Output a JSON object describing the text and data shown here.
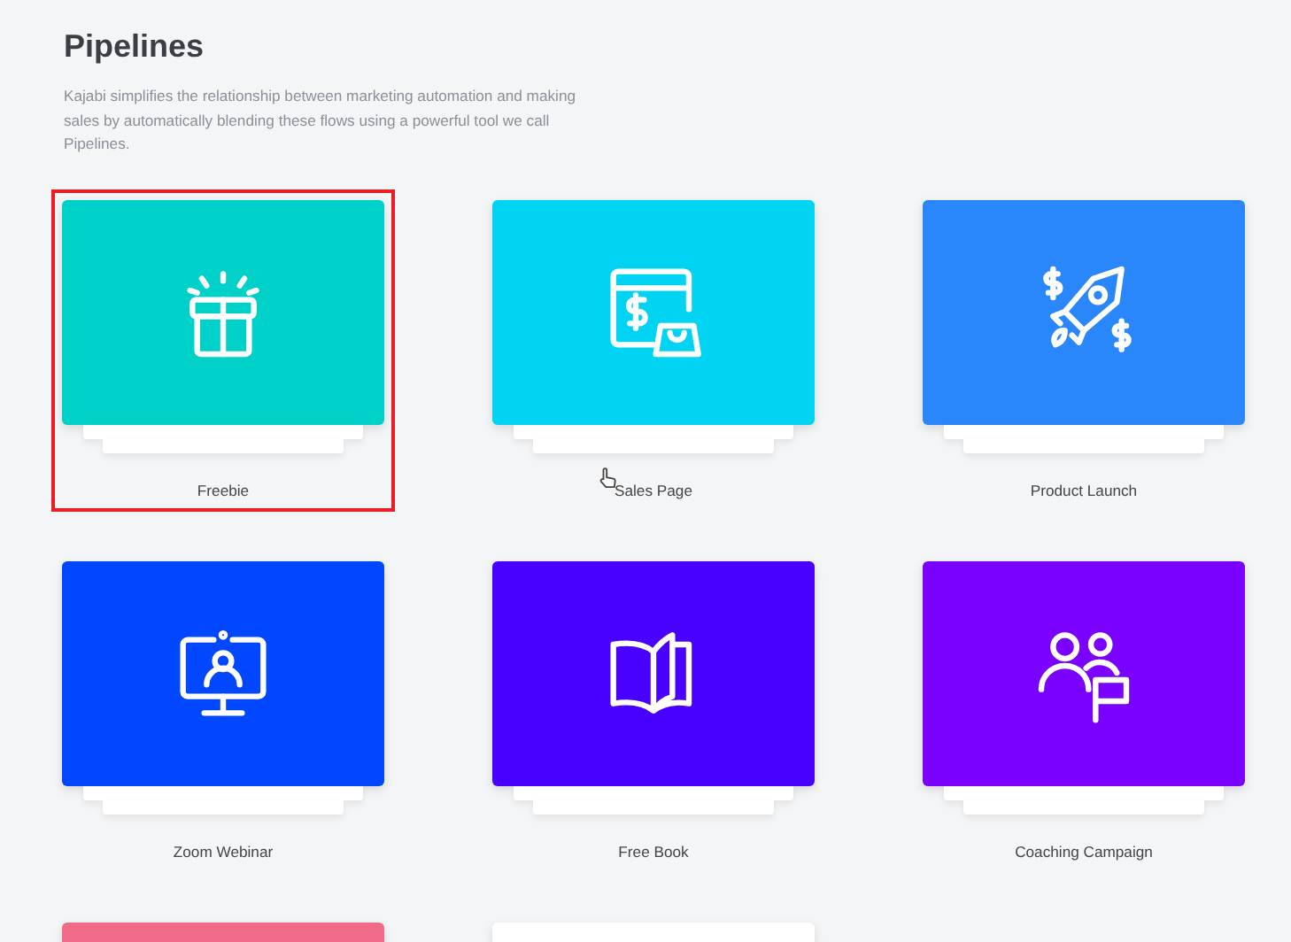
{
  "page": {
    "title": "Pipelines",
    "description": "Kajabi simplifies the relationship between marketing automation and making sales by automatically blending these flows using a powerful tool we call Pipelines."
  },
  "pipelines": [
    {
      "label": "Freebie",
      "kind": "gift",
      "color": "#00d1c8",
      "selected": true
    },
    {
      "label": "Sales Page",
      "kind": "store",
      "color": "#00d4f2",
      "selected": false
    },
    {
      "label": "Product Launch",
      "kind": "rocket",
      "color": "#2a86fb",
      "selected": false
    },
    {
      "label": "Zoom Webinar",
      "kind": "monitor",
      "color": "#0047ff",
      "selected": false
    },
    {
      "label": "Free Book",
      "kind": "book",
      "color": "#4800ff",
      "selected": false
    },
    {
      "label": "Coaching Campaign",
      "kind": "coaching",
      "color": "#7a00ff",
      "selected": false
    },
    {
      "kind": "blank",
      "color": "#ef6b88",
      "selected": false
    },
    {
      "kind": "blank",
      "color": "#ffffff",
      "selected": false
    }
  ]
}
